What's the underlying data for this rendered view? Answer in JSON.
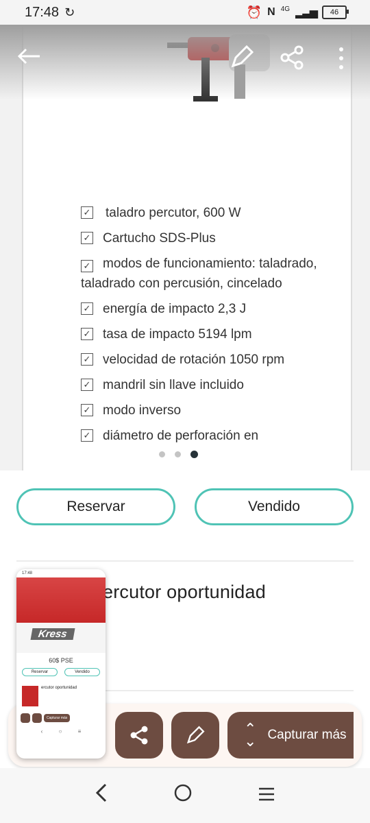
{
  "status_bar": {
    "time": "17:48",
    "network": "4G",
    "battery": "46"
  },
  "toolbar": {
    "back_icon": "arrow-left-icon",
    "edit_icon": "pencil-icon",
    "share_icon": "share-icon",
    "more_icon": "more-vertical-icon"
  },
  "specs": [
    "taladro percutor, 600 W",
    "Cartucho SDS-Plus",
    "modos de funcionamiento: taladrado, taladrado con percusión, cincelado",
    "energía de impacto 2,3 J",
    "tasa de impacto 5194 lpm",
    "velocidad de rotación 1050 rpm",
    "mandril sin llave incluido",
    "modo inverso",
    "diámetro de perforación en"
  ],
  "carousel": {
    "total": 3,
    "active_index": 2
  },
  "actions": {
    "reserve_label": "Reservar",
    "sold_label": "Vendido"
  },
  "listing": {
    "title": "ercutor oportunidad"
  },
  "screenshot_thumb": {
    "time": "17:48",
    "brand": "Kress",
    "price": "60$ PSE",
    "reserve_label": "Reservar",
    "sold_label": "Vendido",
    "title": "ercutor oportunidad",
    "capture_label": "Capturar más"
  },
  "capture_bar": {
    "share_icon": "share-icon",
    "edit_icon": "pencil-icon",
    "capture_label": "Capturar más"
  },
  "nav": {
    "back_icon": "chevron-left-icon",
    "home_icon": "circle-home-icon",
    "menu_icon": "menu-icon"
  },
  "colors": {
    "accent": "#4fc3b5",
    "action": "#6d4c41"
  }
}
